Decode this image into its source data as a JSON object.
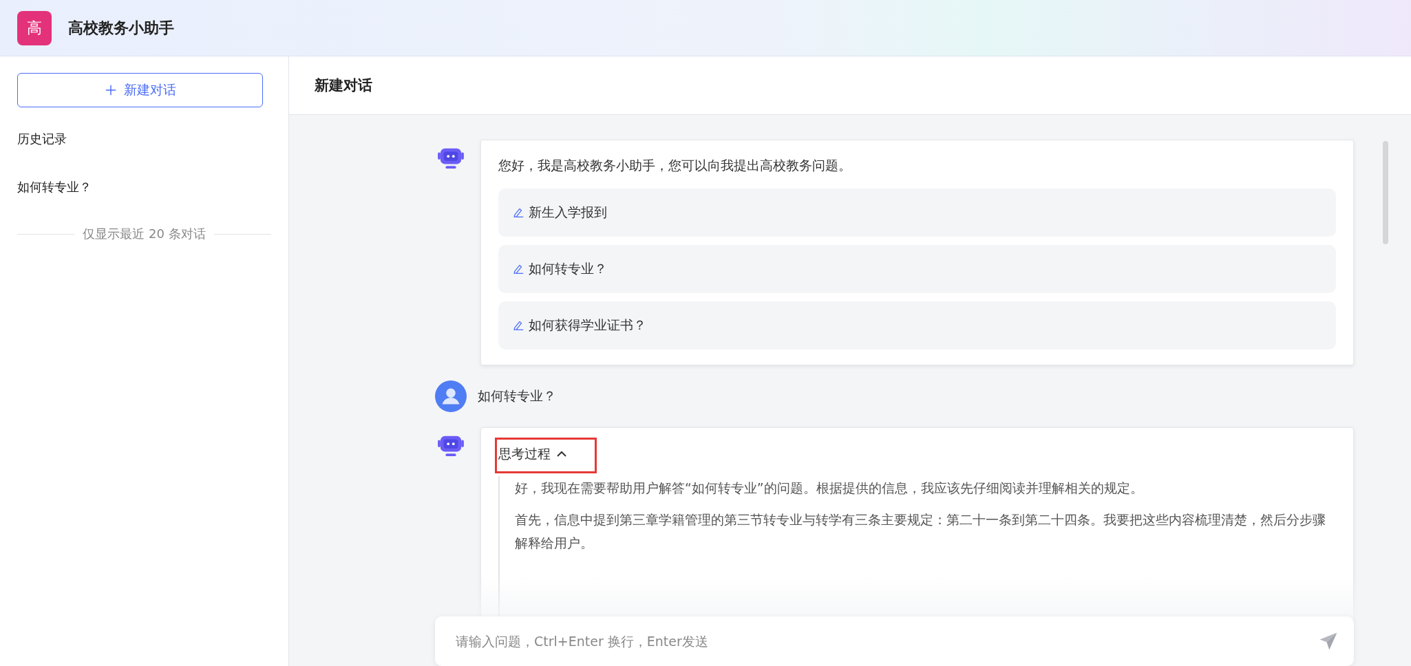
{
  "app": {
    "logo_char": "高",
    "title": "高校教务小助手"
  },
  "sidebar": {
    "new_chat": "新建对话",
    "history_label": "历史记录",
    "history": [
      {
        "title": "如何转专业？",
        "selected": false
      }
    ],
    "footer_note": "仅显示最近 20 条对话"
  },
  "conversation": {
    "title": "新建对话",
    "messages": [
      {
        "kind": "bot_welcome",
        "text": "您好，我是高校教务小助手，您可以向我提出高校教务问题。",
        "suggestions": [
          "新生入学报到",
          "如何转专业？",
          "如何获得学业证书？"
        ]
      },
      {
        "kind": "user",
        "text": "如何转专业？"
      },
      {
        "kind": "bot_thinking",
        "label": "思考过程",
        "expanded": true,
        "highlighted": true,
        "paragraphs": [
          "好，我现在需要帮助用户解答“如何转专业”的问题。根据提供的信息，我应该先仔细阅读并理解相关的规定。",
          "首先，信息中提到第三章学籍管理的第三节转专业与转学有三条主要规定：第二十一条到第二十四条。我要把这些内容梳理清楚，然后分步骤解释给用户。"
        ]
      }
    ]
  },
  "input": {
    "placeholder": "请输入问题，Ctrl+Enter 换行，Enter发送"
  }
}
